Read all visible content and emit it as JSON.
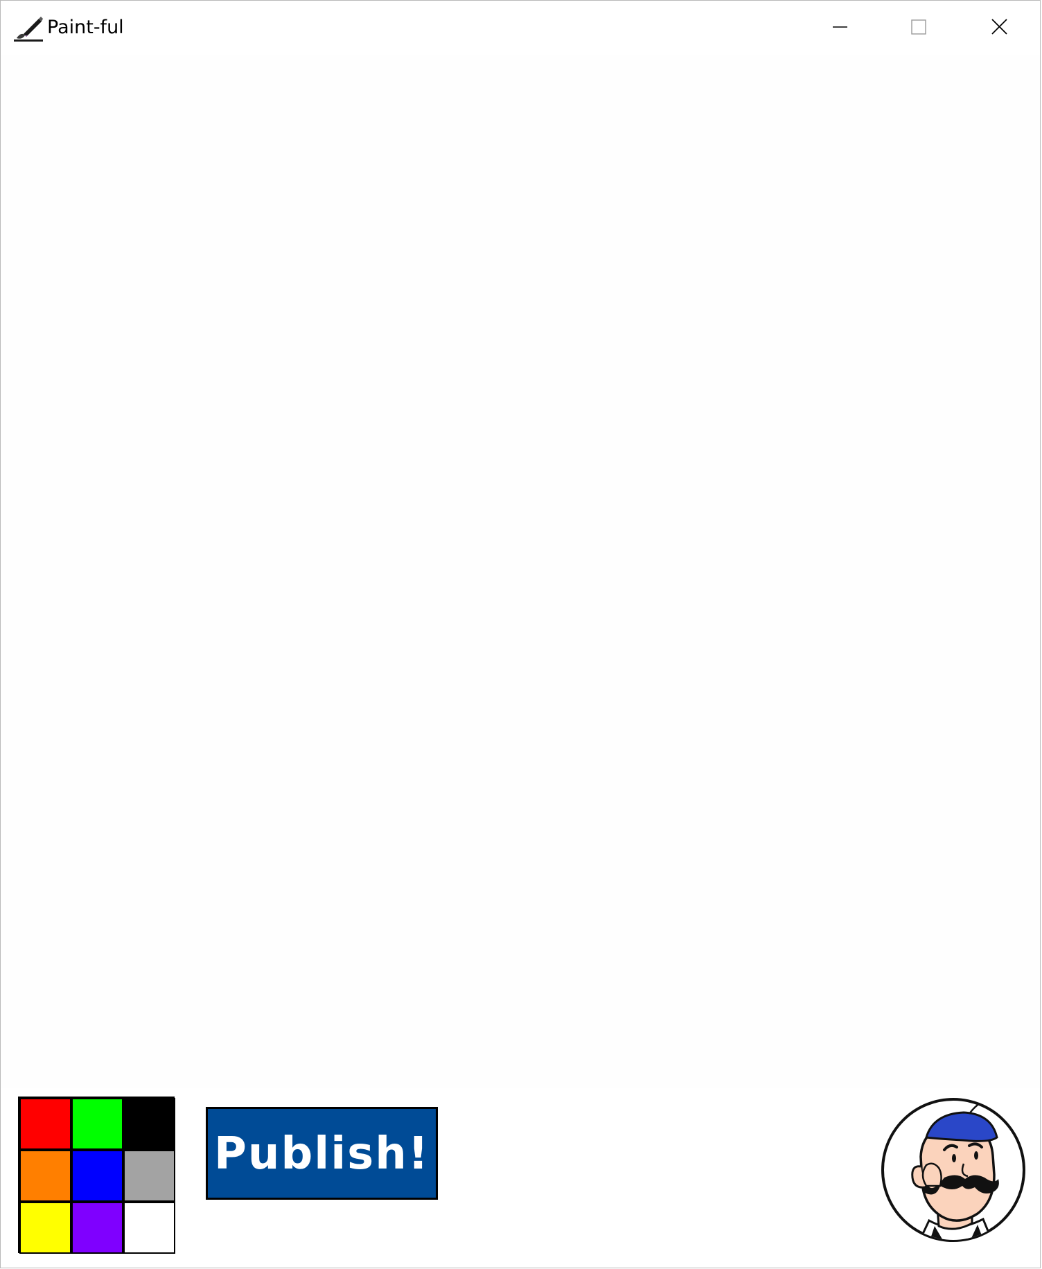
{
  "window": {
    "title": "Paint-ful",
    "controls": {
      "minimize_icon": "minimize-icon",
      "maximize_icon": "maximize-icon",
      "close_icon": "close-icon"
    }
  },
  "canvas": {
    "background": "#fefefe"
  },
  "palette": {
    "colors": [
      {
        "name": "red",
        "hex": "#ff0000"
      },
      {
        "name": "green",
        "hex": "#00ff00"
      },
      {
        "name": "black",
        "hex": "#000000"
      },
      {
        "name": "orange",
        "hex": "#ff7f00"
      },
      {
        "name": "blue",
        "hex": "#0000ff"
      },
      {
        "name": "gray",
        "hex": "#a3a3a3"
      },
      {
        "name": "yellow",
        "hex": "#ffff00"
      },
      {
        "name": "purple",
        "hex": "#7f00ff"
      },
      {
        "name": "white",
        "hex": "#ffffff"
      }
    ]
  },
  "toolbar": {
    "publish_label": "Publish!",
    "publish_color": "#004b96"
  },
  "avatar": {
    "icon": "mascot-avatar-icon",
    "cap_color": "#2a47c8",
    "skin_color": "#fbd3bc"
  }
}
